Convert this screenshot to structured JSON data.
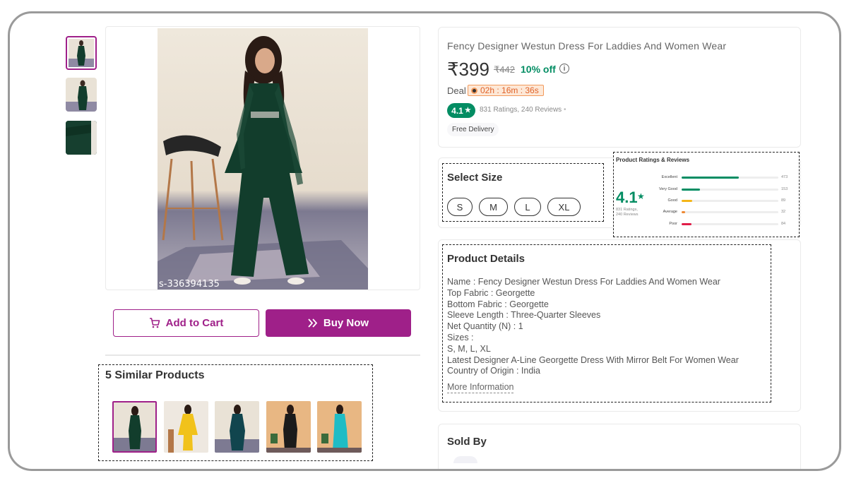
{
  "colors": {
    "brand": "#9f2089",
    "rating_green": "#038d63",
    "timer_orange": "#e0632a"
  },
  "gallery": {
    "thumbnails": [
      {
        "name": "thumb-front",
        "selected": true
      },
      {
        "name": "thumb-side",
        "selected": false
      },
      {
        "name": "thumb-fabric-closeup",
        "selected": false
      }
    ],
    "main_watermark": "s-336394135"
  },
  "actions": {
    "cart_icon": "cart-icon",
    "add_to_cart": "Add to Cart",
    "buy_icon": "double-chevron-right-icon",
    "buy_now": "Buy Now"
  },
  "similar": {
    "title": "5 Similar Products",
    "items": [
      {
        "outfit": "dark-green",
        "selected": true
      },
      {
        "outfit": "yellow",
        "selected": false
      },
      {
        "outfit": "teal",
        "selected": false
      },
      {
        "outfit": "black",
        "selected": false
      },
      {
        "outfit": "turquoise",
        "selected": false
      }
    ]
  },
  "product": {
    "title": "Fency Designer Westun Dress For Laddies And Women Wear",
    "price": "₹399",
    "mrp": "₹442",
    "discount": "10% off",
    "info_icon": "info-icon",
    "deal_label": "Deal",
    "deal_timer": "02h : 16m : 36s",
    "rating_badge": "4.1",
    "rating_summary": "831 Ratings, 240 Reviews",
    "free_delivery": "Free Delivery"
  },
  "size": {
    "title": "Select Size",
    "options": [
      "S",
      "M",
      "L",
      "XL"
    ]
  },
  "ratings": {
    "title": "Product Ratings & Reviews",
    "average": "4.1",
    "star": "★",
    "sub": "831 Ratings, 240 Reviews",
    "breakdown": [
      {
        "label": "Excellent",
        "count": "473",
        "value": 473,
        "color": "#038d63"
      },
      {
        "label": "Very Good",
        "count": "153",
        "value": 153,
        "color": "#038d63"
      },
      {
        "label": "Good",
        "count": "89",
        "value": 89,
        "color": "#f4b619"
      },
      {
        "label": "Average",
        "count": "32",
        "value": 32,
        "color": "#ef8934"
      },
      {
        "label": "Poor",
        "count": "84",
        "value": 84,
        "color": "#e11d48"
      }
    ],
    "max": 800
  },
  "details": {
    "title": "Product Details",
    "lines": [
      "Name : Fency Designer Westun Dress For Laddies And Women Wear",
      "Top Fabric : Georgette",
      "Bottom Fabric : Georgette",
      "Sleeve Length : Three-Quarter Sleeves",
      "Net Quantity (N) : 1",
      "Sizes :",
      "S, M, L, XL",
      "Latest Designer A-Line Georgette Dress With Mirror Belt For Women Wear",
      "Country of Origin : India"
    ],
    "more": "More Information"
  },
  "seller": {
    "title": "Sold By"
  }
}
